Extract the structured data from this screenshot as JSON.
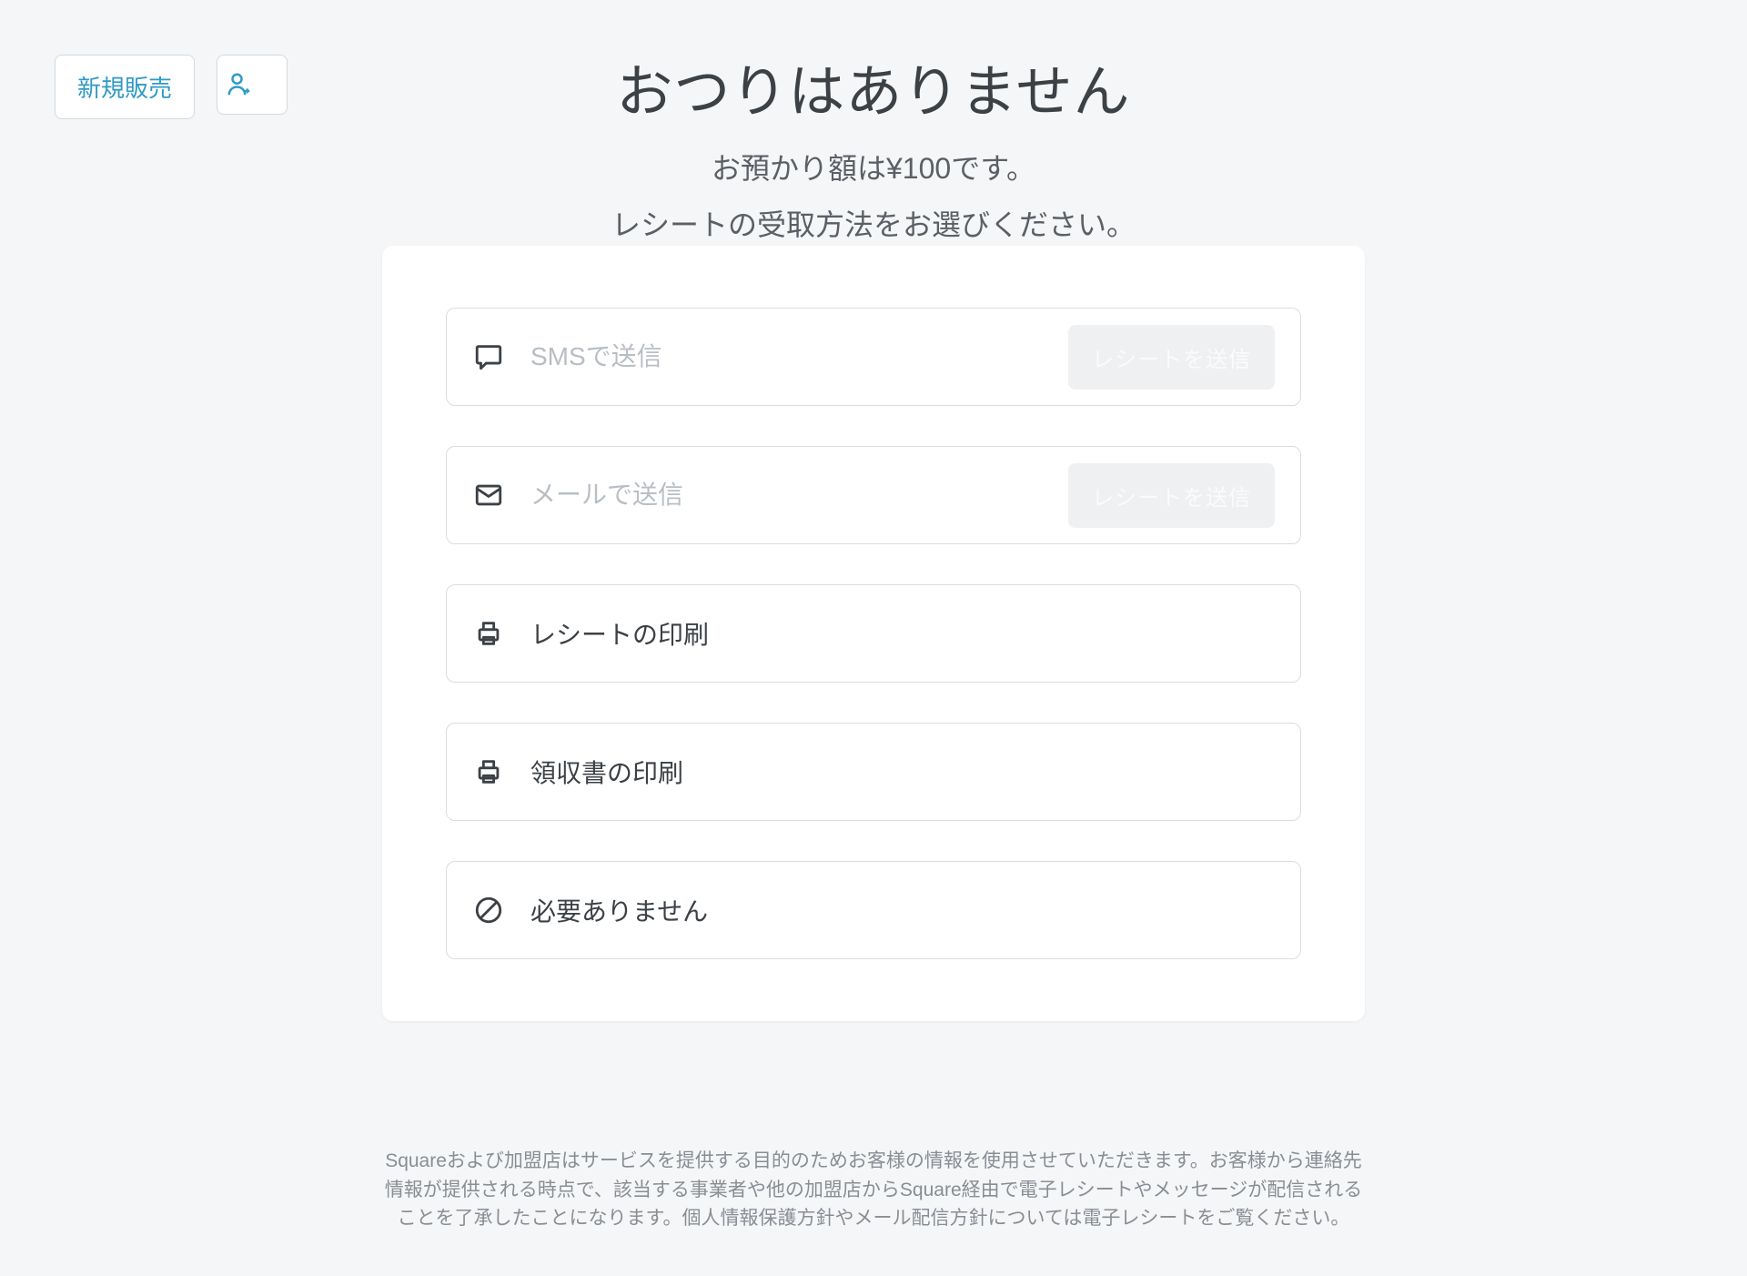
{
  "header": {
    "new_sale_label": "新規販売",
    "title": "おつりはありません",
    "subtitle": "お預かり額は¥100です。",
    "instruction": "レシートの受取方法をお選びください。"
  },
  "options": {
    "sms": {
      "placeholder": "SMSで送信",
      "send_label": "レシートを送信"
    },
    "email": {
      "placeholder": "メールで送信",
      "send_label": "レシートを送信"
    },
    "print_receipt": {
      "label": "レシートの印刷"
    },
    "print_invoice": {
      "label": "領収書の印刷"
    },
    "no_receipt": {
      "label": "必要ありません"
    }
  },
  "footer": {
    "text": "Squareおよび加盟店はサービスを提供する目的のためお客様の情報を使用させていただきます。お客様から連絡先情報が提供される時点で、該当する事業者や他の加盟店からSquare経由で電子レシートやメッセージが配信されることを了承したことになります。個人情報保護方針やメール配信方針については電子レシートをご覧ください。"
  }
}
